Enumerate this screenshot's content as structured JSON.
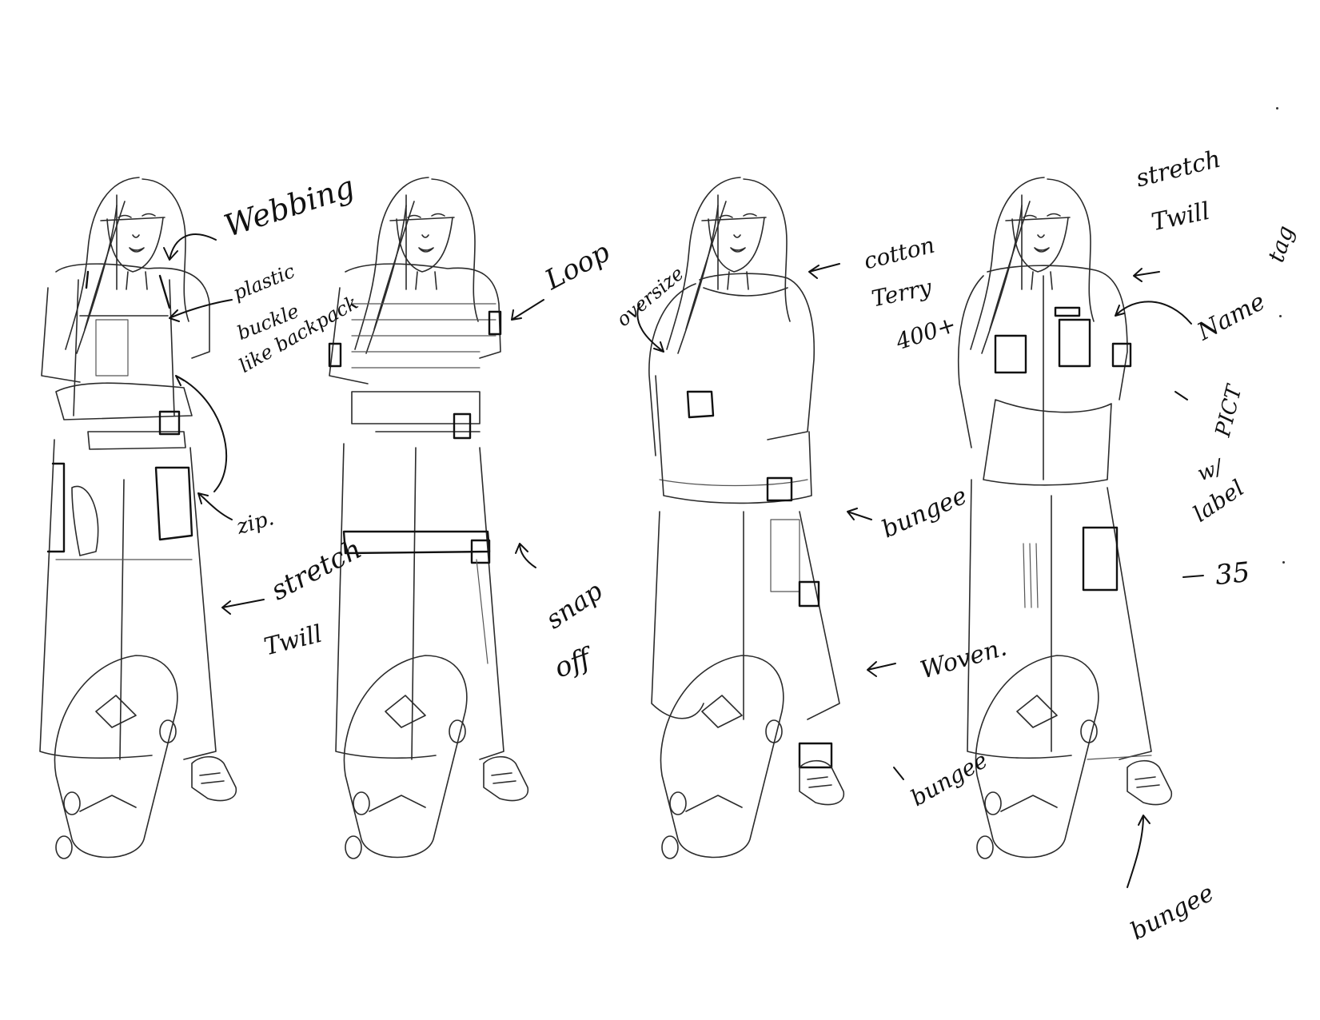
{
  "colors": {
    "paper": "#ffffff",
    "ink": "#111111",
    "pencil": "#2b2b2b"
  },
  "looks": [
    {
      "name": "look-1-overalls",
      "notes": {
        "webbing": "Webbing",
        "buckle_1": "plastic",
        "buckle_2": "buckle",
        "buckle_3": "like backpack",
        "zip": "zip.",
        "stretch": "stretch",
        "twill": "Twill"
      }
    },
    {
      "name": "look-2-snap-off",
      "notes": {
        "loop": "Loop",
        "snap": "snap",
        "off": "off"
      }
    },
    {
      "name": "look-3-oversize",
      "notes": {
        "oversize": "oversize",
        "cotton": "cotton",
        "terry": "Terry",
        "count": "400+",
        "bungee_1": "bungee",
        "woven": "Woven.",
        "bungee_2": "bungee"
      }
    },
    {
      "name": "look-4-jacket",
      "notes": {
        "stretch": "stretch",
        "twill": "Twill",
        "name_tag_1": "Name",
        "name_tag_2": "tag",
        "pict_1": "PICT",
        "pict_2": "w/",
        "pict_3": "label",
        "three_five": "35",
        "bungee": "bungee"
      }
    }
  ]
}
